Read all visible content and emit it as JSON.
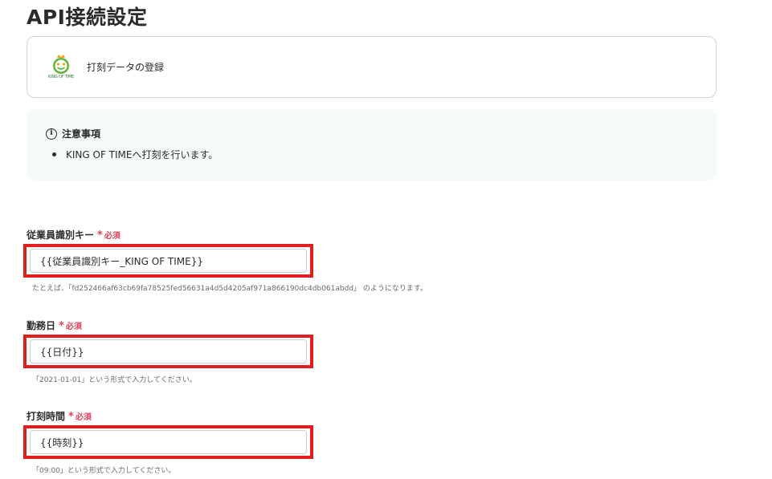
{
  "page": {
    "title": "API接続設定"
  },
  "action": {
    "label": "打刻データの登録",
    "logo_icon": "king-of-time-logo",
    "logo_text": "KING OF TIME"
  },
  "notice": {
    "title": "注意事項",
    "items": [
      "KING OF TIMEへ打刻を行います。"
    ]
  },
  "fields": [
    {
      "label": "従業員識別キー",
      "required_mark": "*",
      "required_text": "必須",
      "value": "{{従業員識別キー_KING OF TIME}}",
      "hint": "たとえば、「fd252466af63cb69fa78525fed56631a4d5d4205af971a866190dc4db061abdd」 のようになります。"
    },
    {
      "label": "勤務日",
      "required_mark": "*",
      "required_text": "必須",
      "value": "{{日付}}",
      "hint": "「2021-01-01」という形式で入力してください。"
    },
    {
      "label": "打刻時間",
      "required_mark": "*",
      "required_text": "必須",
      "value": "{{時刻}}",
      "hint": "「09:00」という形式で入力してください。"
    }
  ],
  "colors": {
    "highlight": "#e01e1e",
    "required": "#e0435a",
    "notice_bg": "#f3faf9"
  }
}
